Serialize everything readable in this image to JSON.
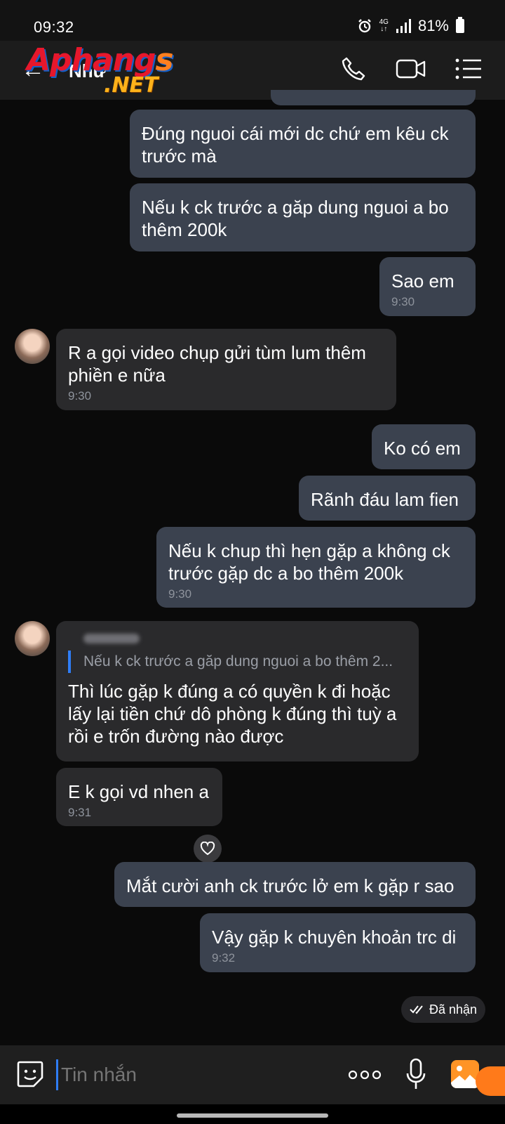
{
  "status_bar": {
    "time": "09:32",
    "network": "4G",
    "battery": "81%"
  },
  "header": {
    "back_icon": "arrow-left-icon",
    "contact_name": "Như",
    "watermark": {
      "line1": "Aphangs",
      "line2": ".NET"
    },
    "icons": [
      "phone-icon",
      "video-call-icon",
      "menu-list-icon"
    ]
  },
  "messages": [
    {
      "dir": "sent",
      "text": "Đúng nguoi cái mới dc chứ em kêu ck trước mà",
      "time": ""
    },
    {
      "dir": "sent",
      "text": "Nếu k ck trước a găp dung nguoi a bo thêm 200k",
      "time": ""
    },
    {
      "dir": "sent",
      "text": "Sao em",
      "time": "9:30"
    },
    {
      "dir": "received",
      "text": "R a gọi video chụp gửi tùm lum thêm phiền e nữa",
      "time": "9:30"
    },
    {
      "dir": "sent",
      "text": "Ko có em",
      "time": ""
    },
    {
      "dir": "sent",
      "text": "Rãnh đáu lam fien",
      "time": ""
    },
    {
      "dir": "sent",
      "text": "Nếu k chup thì hẹn gặp a không ck trước gặp dc a bo thêm 200k",
      "time": "9:30"
    },
    {
      "dir": "received",
      "reply_to": "Nếu k ck trước a găp dung nguoi a bo thêm 2...",
      "text": "Thì lúc gặp k đúng a có quyền k đi hoặc lấy lại tiền chứ dô phòng k đúng thì tuỳ a rồi e trốn đường nào được",
      "time": ""
    },
    {
      "dir": "received",
      "text": "E k gọi vd nhen a",
      "time": "9:31"
    },
    {
      "dir": "sent",
      "text": "Mắt cười anh ck trước lở em k gặp r sao",
      "time": ""
    },
    {
      "dir": "sent",
      "text": "Vậy gặp k chuyên khoản trc di",
      "time": "9:32"
    }
  ],
  "delivery_status": "Đã nhận",
  "input": {
    "placeholder": "Tin nhắn",
    "icons": [
      "sticker-icon",
      "more-dots-icon",
      "microphone-icon",
      "image-icon"
    ]
  },
  "colors": {
    "sent_bubble": "#3b424f",
    "received_bubble": "#2a2a2c",
    "background": "#0a0a0a",
    "accent": "#2f7df6"
  }
}
